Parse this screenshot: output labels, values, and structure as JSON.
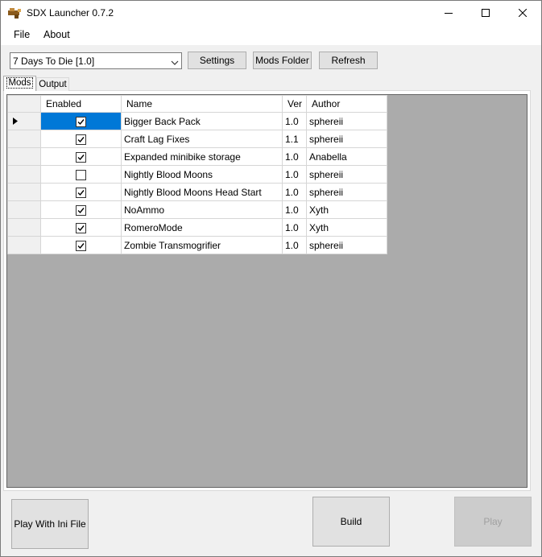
{
  "window": {
    "title": "SDX Launcher 0.7.2"
  },
  "menu": {
    "file": "File",
    "about": "About"
  },
  "toolbar": {
    "game_select_value": "7 Days To Die [1.0]",
    "settings_label": "Settings",
    "mods_folder_label": "Mods Folder",
    "refresh_label": "Refresh"
  },
  "tabs": {
    "mods": "Mods",
    "output": "Output",
    "active": "mods"
  },
  "grid": {
    "columns": {
      "enabled": "Enabled",
      "name": "Name",
      "ver": "Ver",
      "author": "Author"
    },
    "rows": [
      {
        "enabled": true,
        "name": "Bigger Back Pack",
        "ver": "1.0",
        "author": "sphereii",
        "current": true
      },
      {
        "enabled": true,
        "name": "Craft Lag Fixes",
        "ver": "1.1",
        "author": "sphereii",
        "current": false
      },
      {
        "enabled": true,
        "name": "Expanded minibike storage",
        "ver": "1.0",
        "author": "Anabella",
        "current": false
      },
      {
        "enabled": false,
        "name": "Nightly Blood Moons",
        "ver": "1.0",
        "author": "sphereii",
        "current": false
      },
      {
        "enabled": true,
        "name": "Nightly Blood Moons Head Start",
        "ver": "1.0",
        "author": "sphereii",
        "current": false
      },
      {
        "enabled": true,
        "name": "NoAmmo",
        "ver": "1.0",
        "author": "Xyth",
        "current": false
      },
      {
        "enabled": true,
        "name": "RomeroMode",
        "ver": "1.0",
        "author": "Xyth",
        "current": false
      },
      {
        "enabled": true,
        "name": "Zombie Transmogrifier",
        "ver": "1.0",
        "author": "sphereii",
        "current": false
      }
    ]
  },
  "buttons": {
    "play_with_ini": "Play With Ini File",
    "build": "Build",
    "play": "Play"
  },
  "icons": {
    "app": "sdx-launcher-icon",
    "minimize": "minimize-icon",
    "maximize": "maximize-icon",
    "close": "close-icon",
    "dropdown": "chevron-down-icon",
    "row_indicator": "row-pointer-icon",
    "checkbox_checked": "checkbox-checked-icon",
    "checkbox_unchecked": "checkbox-unchecked-icon"
  },
  "colors": {
    "selection": "#0078d7",
    "grid_background": "#ababab",
    "window_background": "#f0f0f0"
  }
}
